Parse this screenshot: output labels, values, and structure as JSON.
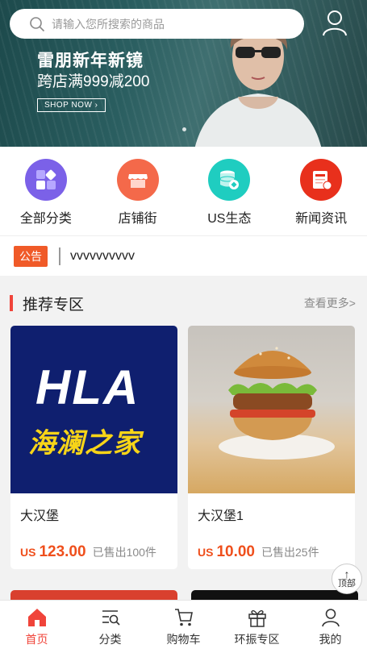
{
  "search": {
    "placeholder": "请输入您所搜索的商品"
  },
  "banner": {
    "title": "雷朋新年新镜",
    "subtitle": "跨店满999减200",
    "button": "SHOP NOW"
  },
  "categories": [
    {
      "label": "全部分类",
      "icon": "grid-icon",
      "color": "#7b61e8"
    },
    {
      "label": "店铺街",
      "icon": "store-icon",
      "color": "#f4694a"
    },
    {
      "label": "US生态",
      "icon": "database-icon",
      "color": "#1fcdc0"
    },
    {
      "label": "新闻资讯",
      "icon": "news-icon",
      "color": "#e8301c"
    }
  ],
  "notice": {
    "badge": "公告",
    "text": "vvvvvvvvvv"
  },
  "recommend": {
    "title": "推荐专区",
    "more": "查看更多>",
    "products": [
      {
        "name": "大汉堡",
        "currency": "US",
        "price": "123.00",
        "sold": "已售出100件",
        "image_text": "HLA",
        "image_text_cn": "海澜之家"
      },
      {
        "name": "大汉堡1",
        "currency": "US",
        "price": "10.00",
        "sold": "已售出25件"
      }
    ]
  },
  "to_top": {
    "label": "顶部"
  },
  "tabbar": [
    {
      "label": "首页",
      "icon": "home-icon",
      "active": true
    },
    {
      "label": "分类",
      "icon": "category-search-icon"
    },
    {
      "label": "购物车",
      "icon": "cart-icon"
    },
    {
      "label": "环振专区",
      "icon": "gift-icon"
    },
    {
      "label": "我的",
      "icon": "user-icon"
    }
  ],
  "colors": {
    "accent": "#f0443a",
    "price": "#ef4f1c",
    "notice_badge": "#f05a28"
  }
}
